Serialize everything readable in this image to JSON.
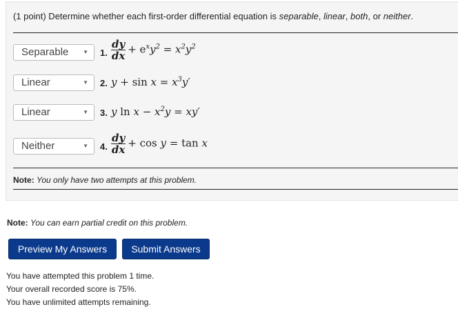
{
  "intro": {
    "points": "(1 point) Determine whether each first-order differential equation is",
    "opt_separable": "separable",
    "comma1": ",",
    "opt_linear": "linear",
    "comma2": ",",
    "opt_both": "both",
    "or": ", or",
    "opt_neither": "neither",
    "period": "."
  },
  "questions": [
    {
      "number": "1.",
      "answer": "Separable"
    },
    {
      "number": "2.",
      "answer": "Linear"
    },
    {
      "number": "3.",
      "answer": "Linear"
    },
    {
      "number": "4.",
      "answer": "Neither"
    }
  ],
  "equations": {
    "q1_num": "dy",
    "q1_den": "dx",
    "q1_rest_a": "+ e",
    "q1_sup_a": "x",
    "q1_rest_b": "y",
    "q1_sup_b": "2",
    "q1_rest_c": " = x",
    "q1_sup_c": "2",
    "q1_rest_d": "y",
    "q1_sup_d": "2",
    "q2_a": "y + ",
    "q2_sin": "sin",
    "q2_b": " x = x",
    "q2_sup": "3",
    "q2_c": "y′",
    "q3_a": "y ",
    "q3_ln": "ln",
    "q3_b": " x − x",
    "q3_sup": "2",
    "q3_c": "y = xy′",
    "q4_num": "dy",
    "q4_den": "dx",
    "q4_a": "+ ",
    "q4_cos": "cos",
    "q4_b": " y = ",
    "q4_tan": "tan",
    "q4_c": " x"
  },
  "note_inside": {
    "label": "Note:",
    "text": "You only have two attempts at this problem."
  },
  "note_outside": {
    "label": "Note:",
    "text": "You can earn partial credit on this problem."
  },
  "buttons": {
    "preview": "Preview My Answers",
    "submit": "Submit Answers"
  },
  "status": [
    "You have attempted this problem 1 time.",
    "Your overall recorded score is 75%.",
    "You have unlimited attempts remaining."
  ]
}
